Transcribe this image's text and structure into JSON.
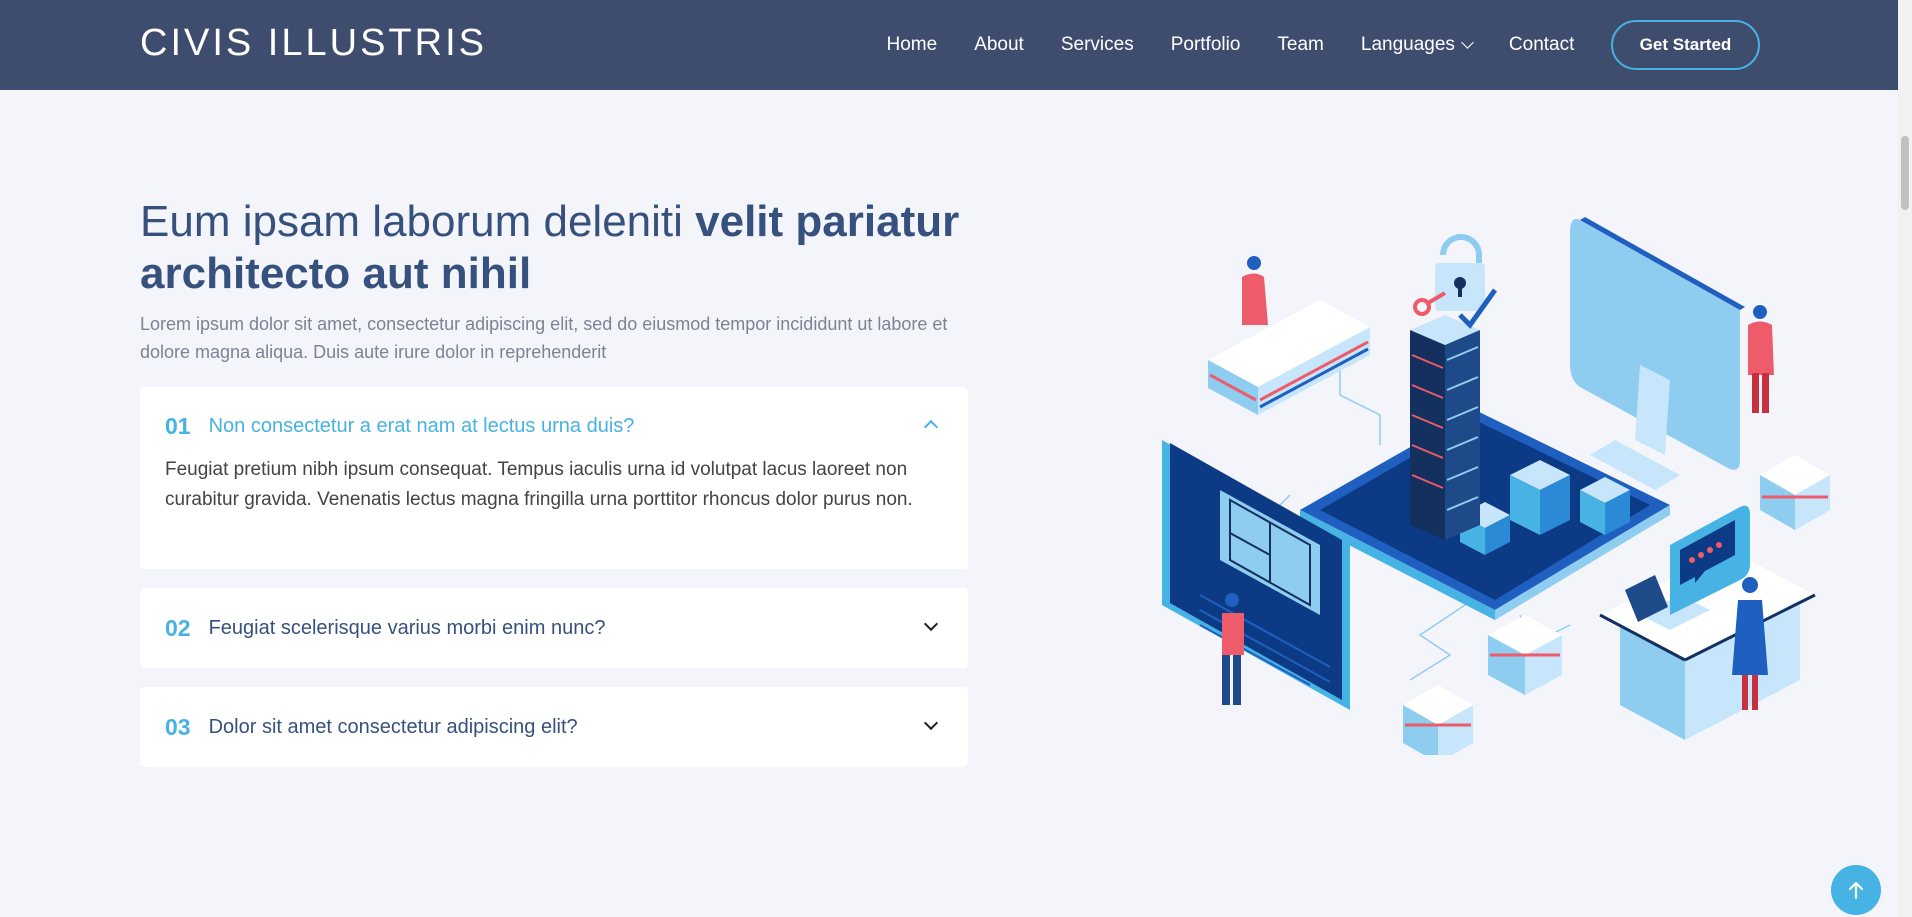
{
  "header": {
    "logo": "CIVIS ILLUSTRIS",
    "nav": [
      "Home",
      "About",
      "Services",
      "Portfolio",
      "Team",
      "Languages",
      "Contact"
    ],
    "cta": "Get Started"
  },
  "section": {
    "title_regular": "Eum ipsam laborum deleniti ",
    "title_bold": "velit pariatur architecto aut nihil",
    "lead": "Lorem ipsum dolor sit amet, consectetur adipiscing elit, sed do eiusmod tempor incididunt ut labore et dolore magna aliqua. Duis aute irure dolor in reprehenderit"
  },
  "faq": [
    {
      "num": "01",
      "question": "Non consectetur a erat nam at lectus urna duis?",
      "answer": "Feugiat pretium nibh ipsum consequat. Tempus iaculis urna id volutpat lacus laoreet non curabitur gravida. Venenatis lectus magna fringilla urna porttitor rhoncus dolor purus non.",
      "open": true
    },
    {
      "num": "02",
      "question": "Feugiat scelerisque varius morbi enim nunc?",
      "open": false
    },
    {
      "num": "03",
      "question": "Dolor sit amet consectetur adipiscing elit?",
      "open": false
    }
  ],
  "icons": {
    "languages_dropdown": "chevron-down-icon",
    "faq_open": "chevron-up-icon",
    "faq_closed": "chevron-down-icon",
    "back_to_top": "arrow-up-icon"
  },
  "colors": {
    "header_bg": "#3e4d6d",
    "accent": "#47b2e4",
    "heading": "#37517e",
    "page_bg": "#f3f5fa"
  }
}
